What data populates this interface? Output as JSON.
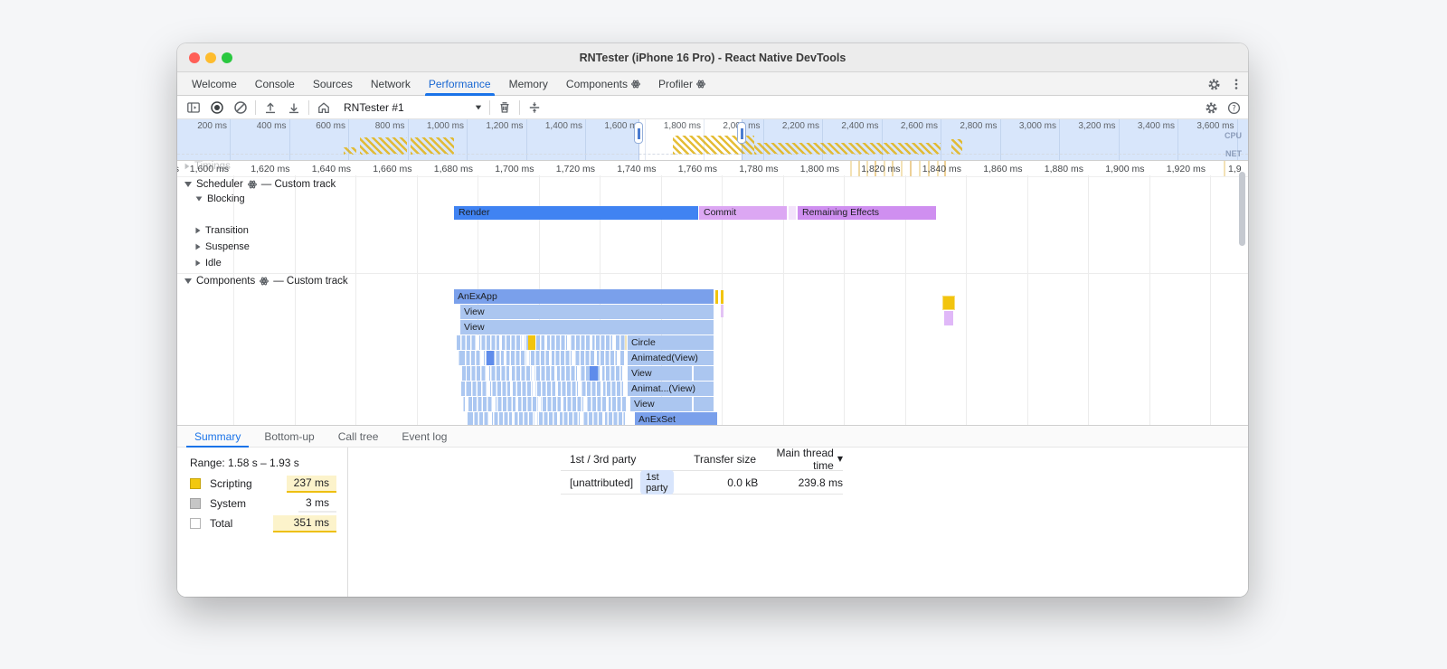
{
  "colors": {
    "accent_blue": "#1a73e8",
    "render_bar": "#4083f2",
    "commit_bar": "#dca7f3",
    "effects_bar": "#cf8ff0",
    "flame_dark": "#7aa0eb",
    "flame_light": "#abc6f0",
    "scripting_yellow": "#f2c80f",
    "system_gray": "#c6c6c6",
    "cpu_hatch_yellow": "#e2b620",
    "overview_shade_blue": "#d8e6fb"
  },
  "titlebar": {
    "title": "RNTester (iPhone 16 Pro) - React Native DevTools"
  },
  "devtools_tabs": {
    "items": [
      {
        "label": "Welcome"
      },
      {
        "label": "Console"
      },
      {
        "label": "Sources"
      },
      {
        "label": "Network"
      },
      {
        "label": "Performance"
      },
      {
        "label": "Memory"
      },
      {
        "label": "Components"
      },
      {
        "label": "Profiler"
      }
    ]
  },
  "toolbar": {
    "target": "RNTester #1"
  },
  "overview": {
    "ticks": [
      "200 ms",
      "400 ms",
      "600 ms",
      "800 ms",
      "1,000 ms",
      "1,200 ms",
      "1,400 ms",
      "1,600 ms",
      "1,800 ms",
      "2,000 ms",
      "2,200 ms",
      "2,400 ms",
      "2,600 ms",
      "2,800 ms",
      "3,000 ms",
      "3,200 ms",
      "3,400 ms",
      "3,600 ms"
    ],
    "cpu_label": "CPU",
    "net_label": "NET"
  },
  "ruler": {
    "ticks": [
      "1,600 ms",
      "1,620 ms",
      "1,640 ms",
      "1,660 ms",
      "1,680 ms",
      "1,700 ms",
      "1,720 ms",
      "1,740 ms",
      "1,760 ms",
      "1,780 ms",
      "1,800 ms",
      "1,820 ms",
      "1,840 ms",
      "1,860 ms",
      "1,880 ms",
      "1,900 ms",
      "1,920 ms"
    ],
    "partial_tick": "1,9",
    "left_fragment": "s",
    "hidden_track": "Timings"
  },
  "tracks": {
    "scheduler": {
      "name": "Scheduler",
      "suffix": "— Custom track"
    },
    "lanes": {
      "blocking": "Blocking",
      "transition": "Transition",
      "suspense": "Suspense",
      "idle": "Idle"
    },
    "scheduler_bars": {
      "render": "Render",
      "commit": "Commit",
      "effects": "Remaining Effects"
    },
    "components": {
      "name": "Components",
      "suffix": "— Custom track"
    },
    "flame_rows": [
      "AnExApp",
      "View",
      "View",
      "Circle",
      "Animated(View)",
      "View",
      "Animat...(View)",
      "View",
      "AnExSet"
    ]
  },
  "bottom_tabs": {
    "items": [
      {
        "label": "Summary"
      },
      {
        "label": "Bottom-up"
      },
      {
        "label": "Call tree"
      },
      {
        "label": "Event log"
      }
    ]
  },
  "summary": {
    "range": "Range: 1.58 s – 1.93 s",
    "legend": [
      {
        "label": "Scripting",
        "value": "237 ms"
      },
      {
        "label": "System",
        "value": "3 ms"
      },
      {
        "label": "Total",
        "value": "351 ms"
      }
    ]
  },
  "party_table": {
    "headers": {
      "party": "1st / 3rd party",
      "transfer": "Transfer size",
      "time": "Main thread time",
      "sort": "▼"
    },
    "row": {
      "name": "[unattributed]",
      "badge": "1st party",
      "transfer": "0.0 kB",
      "time": "239.8 ms"
    }
  }
}
